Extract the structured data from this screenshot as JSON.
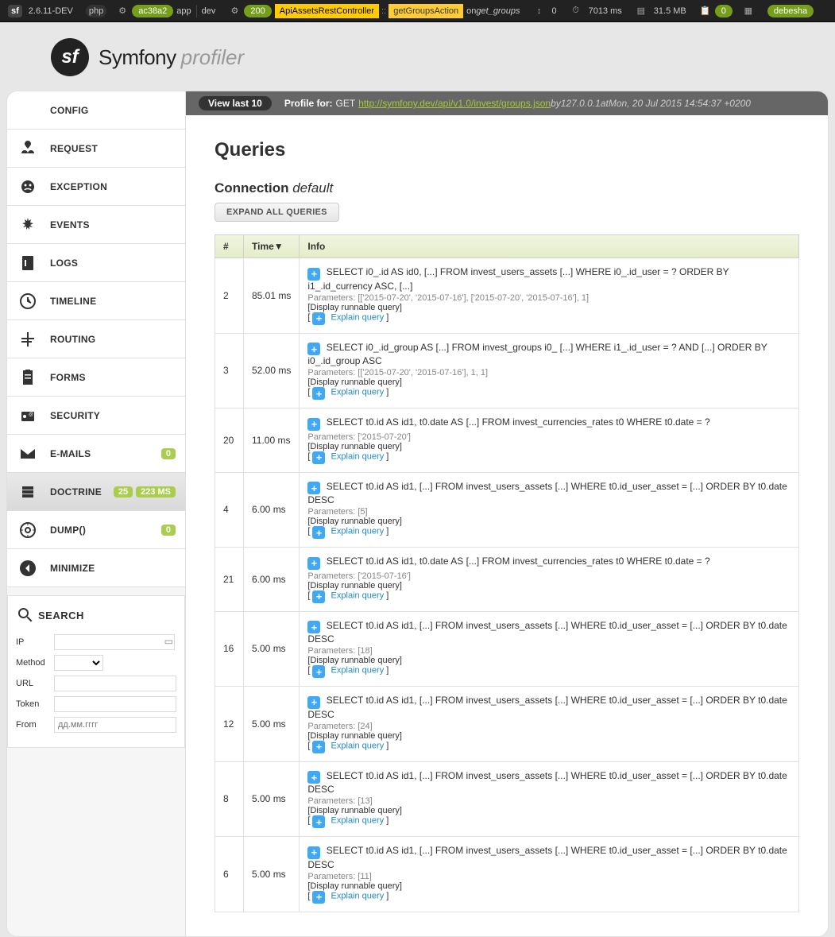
{
  "toolbar": {
    "version": "2.6.11-DEV",
    "token": "ac38a2",
    "env1": "app",
    "env2": "dev",
    "status": "200",
    "controller": "ApiAssetsRestController",
    "action": "getGroupsAction",
    "on_prefix": "on ",
    "on": "get_groups",
    "forms": "0",
    "time": "7013 ms",
    "memory": "31.5 MB",
    "db_count": "0",
    "user": "debesha"
  },
  "brand": {
    "word1": "Symfony",
    "word2": "profiler"
  },
  "sidebar": {
    "items": [
      {
        "label": "CONFIG"
      },
      {
        "label": "REQUEST"
      },
      {
        "label": "EXCEPTION"
      },
      {
        "label": "EVENTS"
      },
      {
        "label": "LOGS"
      },
      {
        "label": "TIMELINE"
      },
      {
        "label": "ROUTING"
      },
      {
        "label": "FORMS"
      },
      {
        "label": "SECURITY"
      },
      {
        "label": "E-MAILS",
        "badges": [
          "0"
        ]
      },
      {
        "label": "DOCTRINE",
        "badges": [
          "25",
          "223 MS"
        ],
        "selected": true
      },
      {
        "label": "DUMP()",
        "badges": [
          "0"
        ]
      },
      {
        "label": "MINIMIZE"
      }
    ]
  },
  "search": {
    "title": "SEARCH",
    "ip_label": "IP",
    "ip_value": "",
    "method_label": "Method",
    "method_value": "",
    "url_label": "URL",
    "url_value": "",
    "token_label": "Token",
    "token_value": "",
    "from_label": "From",
    "from_placeholder": "дд.мм.гггг"
  },
  "profile": {
    "view_last": "View last 10",
    "profile_for": "Profile for:",
    "method": "GET",
    "url": "http://symfony.dev/api/v1.0/invest/groups.json",
    "by": " by ",
    "ip": "127.0.0.1",
    "at": " at ",
    "time": "Mon, 20 Jul 2015 14:54:37 +0200"
  },
  "page": {
    "title": "Queries",
    "connection_label": "Connection ",
    "connection_name": "default",
    "expand_button": "EXPAND ALL QUERIES"
  },
  "table": {
    "headers": {
      "num": "#",
      "time": "Time▼",
      "info": "Info"
    },
    "display_runnable": "[Display runnable query]",
    "explain": "Explain query",
    "params_label": "Parameters: ",
    "rows": [
      {
        "num": "2",
        "time": "85.01 ms",
        "sql": "SELECT i0_.id AS id0, [...] FROM invest_users_assets [...] WHERE i0_.id_user = ? ORDER BY i1_.id_currency ASC, [...]",
        "params": "[['2015-07-20', '2015-07-16'], ['2015-07-20', '2015-07-16'], 1]"
      },
      {
        "num": "3",
        "time": "52.00 ms",
        "sql": "SELECT i0_.id_group AS [...] FROM invest_groups i0_ [...] WHERE i1_.id_user = ? AND [...] ORDER BY i0_.id_group ASC",
        "params": "[['2015-07-20', '2015-07-16'], 1, 1]"
      },
      {
        "num": "20",
        "time": "11.00 ms",
        "sql": "SELECT t0.id AS id1, t0.date AS [...] FROM invest_currencies_rates t0 WHERE t0.date = ?",
        "params": "['2015-07-20']"
      },
      {
        "num": "4",
        "time": "6.00 ms",
        "sql": "SELECT t0.id AS id1, [...] FROM invest_users_assets [...] WHERE t0.id_user_asset = [...] ORDER BY t0.date DESC",
        "params": "[5]"
      },
      {
        "num": "21",
        "time": "6.00 ms",
        "sql": "SELECT t0.id AS id1, t0.date AS [...] FROM invest_currencies_rates t0 WHERE t0.date = ?",
        "params": "['2015-07-16']"
      },
      {
        "num": "16",
        "time": "5.00 ms",
        "sql": "SELECT t0.id AS id1, [...] FROM invest_users_assets [...] WHERE t0.id_user_asset = [...] ORDER BY t0.date DESC",
        "params": "[18]"
      },
      {
        "num": "12",
        "time": "5.00 ms",
        "sql": "SELECT t0.id AS id1, [...] FROM invest_users_assets [...] WHERE t0.id_user_asset = [...] ORDER BY t0.date DESC",
        "params": "[24]"
      },
      {
        "num": "8",
        "time": "5.00 ms",
        "sql": "SELECT t0.id AS id1, [...] FROM invest_users_assets [...] WHERE t0.id_user_asset = [...] ORDER BY t0.date DESC",
        "params": "[13]"
      },
      {
        "num": "6",
        "time": "5.00 ms",
        "sql": "SELECT t0.id AS id1, [...] FROM invest_users_assets [...] WHERE t0.id_user_asset = [...] ORDER BY t0.date DESC",
        "params": "[11]"
      }
    ]
  }
}
